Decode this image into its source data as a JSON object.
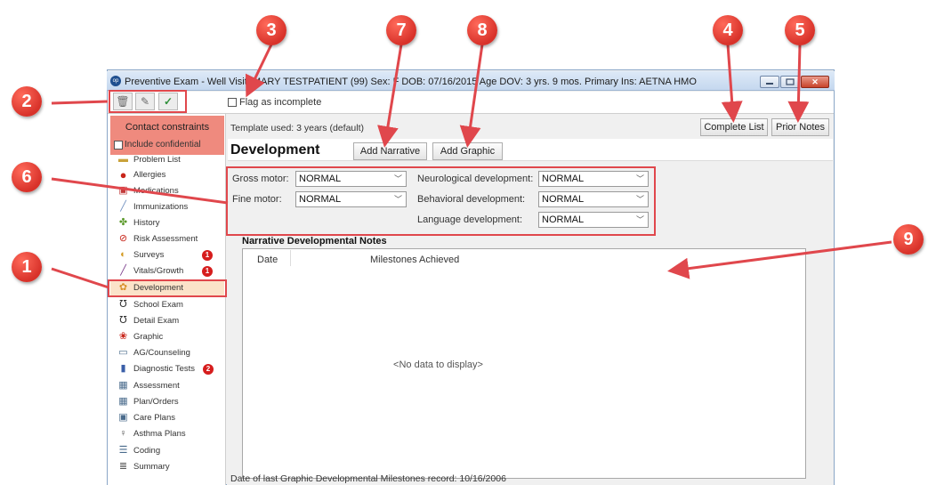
{
  "window": {
    "title": "Preventive Exam - Well Visit:  MARY TESTPATIENT (99)  Sex: F  DOB: 07/16/2015  Age DOV: 3 yrs. 9 mos.  Primary Ins: AETNA HMO",
    "app_icon_text": "op"
  },
  "toolbar": {
    "buttons": [
      "trash-icon",
      "pencil-icon",
      "checkmark-icon"
    ],
    "flag_label": "Flag as incomplete"
  },
  "sidebar": {
    "contact_title": "Contact constraints",
    "include_label": "Include confidential",
    "items": [
      {
        "label": "Problem List",
        "icon": "problem-list-icon"
      },
      {
        "label": "Allergies",
        "icon": "allergies-icon"
      },
      {
        "label": "Medications",
        "icon": "medications-icon"
      },
      {
        "label": "Immunizations",
        "icon": "immunizations-icon"
      },
      {
        "label": "History",
        "icon": "history-icon"
      },
      {
        "label": "Risk Assessment",
        "icon": "risk-assessment-icon"
      },
      {
        "label": "Surveys",
        "icon": "surveys-icon",
        "badge": "1"
      },
      {
        "label": "Vitals/Growth",
        "icon": "vitals-icon",
        "badge": "1"
      },
      {
        "label": "Development",
        "icon": "development-icon"
      },
      {
        "label": "School Exam",
        "icon": "school-exam-icon"
      },
      {
        "label": "Detail Exam",
        "icon": "detail-exam-icon"
      },
      {
        "label": "Graphic",
        "icon": "graphic-icon"
      },
      {
        "label": "AG/Counseling",
        "icon": "counseling-icon"
      },
      {
        "label": "Diagnostic Tests",
        "icon": "diagnostic-tests-icon",
        "badge": "2"
      },
      {
        "label": "Assessment",
        "icon": "assessment-icon"
      },
      {
        "label": "Plan/Orders",
        "icon": "plan-orders-icon"
      },
      {
        "label": "Care Plans",
        "icon": "care-plans-icon"
      },
      {
        "label": "Asthma Plans",
        "icon": "asthma-plans-icon"
      },
      {
        "label": "Coding",
        "icon": "coding-icon"
      },
      {
        "label": "Summary",
        "icon": "summary-icon"
      }
    ]
  },
  "main": {
    "template_label": "Template used:  3 years (default)",
    "complete_list": "Complete List",
    "prior_notes": "Prior Notes",
    "section_title": "Development",
    "add_narrative": "Add Narrative",
    "add_graphic": "Add Graphic",
    "fields": {
      "gross_motor": {
        "label": "Gross motor:",
        "value": "NORMAL"
      },
      "fine_motor": {
        "label": "Fine motor:",
        "value": "NORMAL"
      },
      "neurological": {
        "label": "Neurological development:",
        "value": "NORMAL"
      },
      "behavioral": {
        "label": "Behavioral development:",
        "value": "NORMAL"
      },
      "language": {
        "label": "Language development:",
        "value": "NORMAL"
      }
    },
    "narrative_title": "Narrative Developmental Notes",
    "columns": [
      "Date",
      "Milestones Achieved"
    ],
    "empty_text": "<No data to display>",
    "footer": "Date of last Graphic Developmental Milestones record:  10/16/2006"
  },
  "annotations": [
    "1",
    "2",
    "3",
    "4",
    "5",
    "6",
    "7",
    "8",
    "9"
  ],
  "colors": {
    "highlight": "#e0474c",
    "marker": "#d8322a",
    "contact_box": "#ef8a7e",
    "badge": "#d61d1d"
  }
}
